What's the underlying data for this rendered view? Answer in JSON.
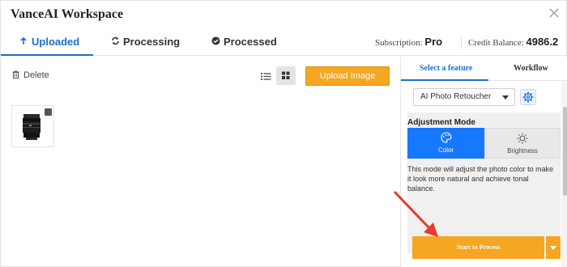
{
  "window": {
    "title": "VanceAI Workspace"
  },
  "tabs": [
    {
      "label": "Uploaded",
      "icon": "upload-arrow-icon",
      "active": true
    },
    {
      "label": "Processing",
      "icon": "refresh-icon",
      "active": false
    },
    {
      "label": "Processed",
      "icon": "check-circle-icon",
      "active": false
    }
  ],
  "account": {
    "subscription_label": "Subscription:",
    "subscription_value": "Pro",
    "credit_label": "Credit Balance:",
    "credit_value": "4986.2"
  },
  "toolbar": {
    "delete_label": "Delete",
    "upload_label": "Upload Image",
    "view_mode": "grid"
  },
  "side": {
    "tabs": [
      {
        "label": "Select a feature",
        "active": true
      },
      {
        "label": "Workflow",
        "active": false
      }
    ],
    "feature_selected": "AI Photo Retoucher",
    "adjustment_title": "Adjustment Mode",
    "modes": [
      {
        "label": "Color",
        "icon": "palette-icon",
        "active": true
      },
      {
        "label": "Brightness",
        "icon": "sun-icon",
        "active": false
      }
    ],
    "description": "This mode will adjust the photo color to make it look more natural and achieve tonal balance.",
    "start_label": "Start to Process"
  },
  "colors": {
    "accent": "#1a6fd0",
    "orange": "#f5a623",
    "mode_active": "#1677ff",
    "arrow": "#e8392c"
  }
}
